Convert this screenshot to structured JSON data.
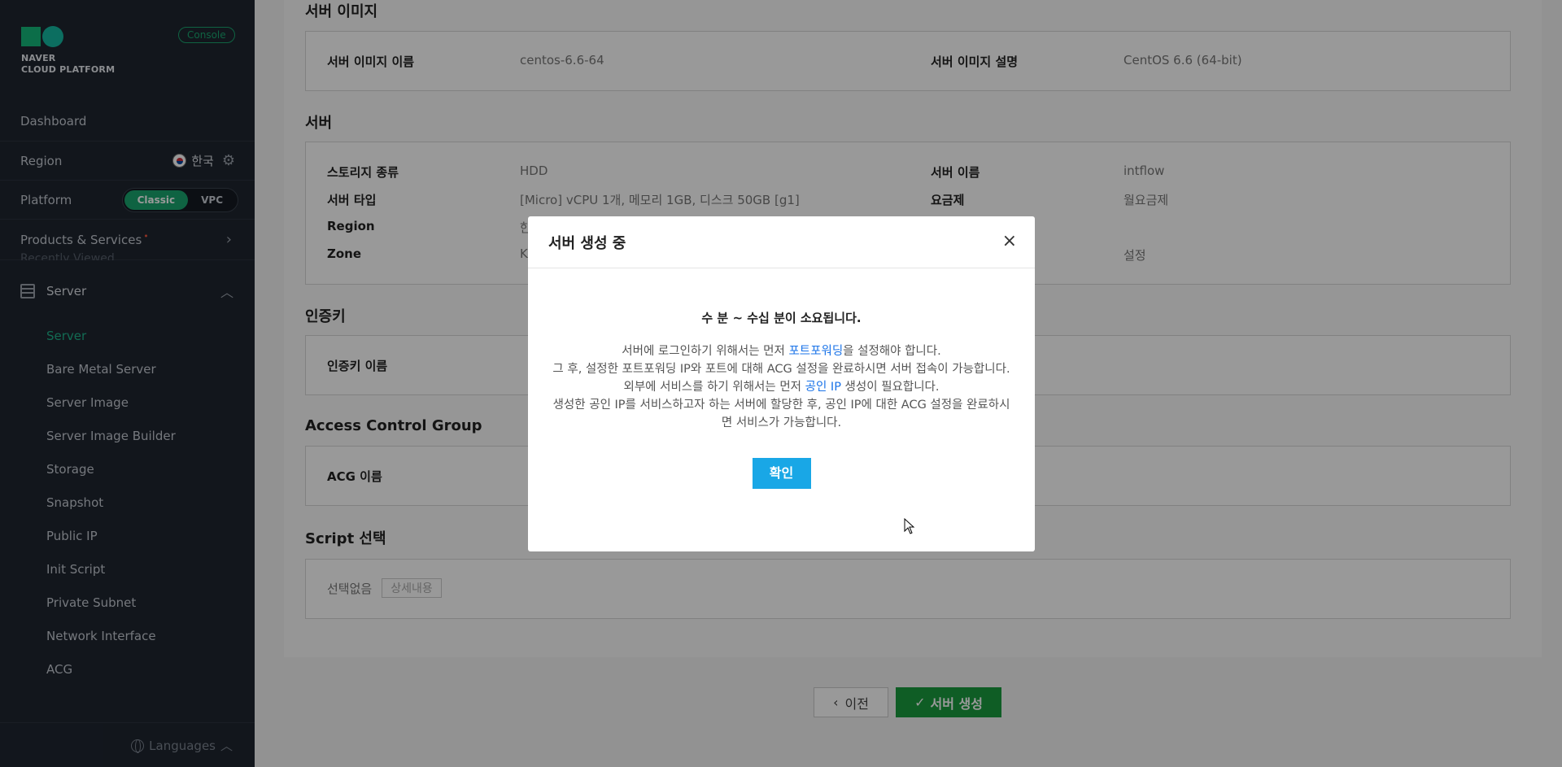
{
  "sidebar": {
    "logo_line1": "NAVER",
    "logo_line2": "CLOUD PLATFORM",
    "console_badge": "Console",
    "dashboard": "Dashboard",
    "region_label": "Region",
    "region_value": "한국",
    "platform_label": "Platform",
    "platform_classic": "Classic",
    "platform_vpc": "VPC",
    "products_label": "Products & Services",
    "products_marker": "•",
    "recently_viewed": "Recently Viewed",
    "server_group": "Server",
    "items": [
      {
        "label": "Server",
        "active": true
      },
      {
        "label": "Bare Metal Server"
      },
      {
        "label": "Server Image"
      },
      {
        "label": "Server Image Builder"
      },
      {
        "label": "Storage"
      },
      {
        "label": "Snapshot"
      },
      {
        "label": "Public IP"
      },
      {
        "label": "Init Script"
      },
      {
        "label": "Private Subnet"
      },
      {
        "label": "Network Interface"
      },
      {
        "label": "ACG"
      }
    ],
    "languages": "Languages"
  },
  "main": {
    "sec_image": "서버 이미지",
    "image_name_k": "서버 이미지 이름",
    "image_name_v": "centos-6.6-64",
    "image_desc_k": "서버 이미지 설명",
    "image_desc_v": "CentOS 6.6 (64-bit)",
    "sec_server": "서버",
    "storage_k": "스토리지 종류",
    "storage_v": "HDD",
    "server_name_k": "서버 이름",
    "server_name_v": "intflow",
    "server_type_k": "서버 타입",
    "server_type_v": "[Micro] vCPU 1개, 메모리 1GB, 디스크 50GB [g1]",
    "plan_k": "요금제",
    "plan_v": "월요금제",
    "region_k": "Region",
    "region_v": "한",
    "zone_k": "Zone",
    "zone_v": "K",
    "setting_v": "설정",
    "sec_authkey": "인증키",
    "authkey_k": "인증키 이름",
    "sec_acg": "Access Control Group",
    "acg_k": "ACG 이름",
    "sec_script": "Script 선택",
    "script_none": "선택없음",
    "script_detail": "상세내용",
    "btn_prev": "이전",
    "btn_create": "서버 생성"
  },
  "modal": {
    "title": "서버 생성 중",
    "close": "×",
    "headline": "수 분 ~ 수십 분이 소요됩니다.",
    "line1_pre": "서버에 로그인하기 위해서는 먼저 ",
    "line1_link": "포트포워딩",
    "line1_post": "을 설정해야 합니다.",
    "line2": "그 후, 설정한 포트포워딩 IP와 포트에 대해 ACG 설정을 완료하시면 서버 접속이 가능합니다.",
    "line3_pre": "외부에 서비스를 하기 위해서는 먼저 ",
    "line3_link": "공인 IP",
    "line3_post": " 생성이 필요합니다.",
    "line4": "생성한 공인 IP를 서비스하고자 하는 서버에 할당한 후, 공인 IP에 대한 ACG 설정을 완료하시면 서비스가 가능합니다.",
    "confirm": "확인"
  },
  "colors": {
    "sidebar_bg": "#1e2530",
    "accent_green": "#1aa56f",
    "create_button": "#1a9b3f",
    "confirm_button": "#19a7e6",
    "link": "#1a73e8"
  }
}
